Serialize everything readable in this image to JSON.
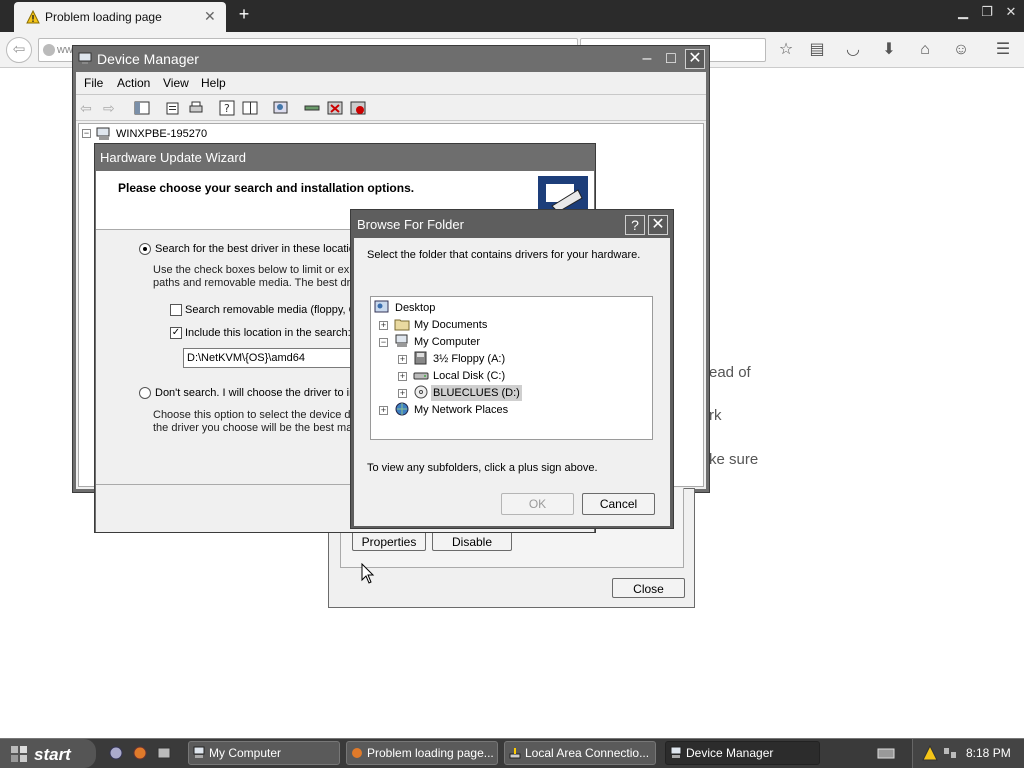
{
  "browser": {
    "tab_title": "Problem loading page",
    "url_prefix": "ww",
    "page_fragments": [
      "ead of",
      "rk",
      "ke sure"
    ]
  },
  "device_manager": {
    "title": "Device Manager",
    "menu": [
      "File",
      "Action",
      "View",
      "Help"
    ],
    "tree_root": "WINXPBE-195270"
  },
  "wizard": {
    "title": "Hardware Update Wizard",
    "heading": "Please choose your search and installation options.",
    "option_search": "Search for the best driver in these location",
    "option_search_desc_1": "Use the check boxes below to limit or exp",
    "option_search_desc_2": "paths and removable media. The best driv",
    "check_removable": "Search removable media (floppy, C",
    "check_include": "Include this location in the search:",
    "path_value": "D:\\NetKVM\\{OS}\\amd64",
    "option_dont": "Don't search. I will choose the driver to in",
    "option_dont_desc_1": "Choose this option to select the device dr",
    "option_dont_desc_2": "the driver you choose will be the best mat"
  },
  "properties_dialog": {
    "properties_label": "Properties",
    "disable_label": "Disable",
    "close_label": "Close"
  },
  "browse": {
    "title": "Browse For Folder",
    "help_label": "?",
    "instruction": "Select the folder that contains drivers for your hardware.",
    "tree": {
      "desktop": "Desktop",
      "my_documents": "My Documents",
      "my_computer": "My Computer",
      "floppy": "3½ Floppy (A:)",
      "local_disk": "Local Disk (C:)",
      "blueclues": "BLUECLUES (D:)",
      "network": "My Network Places"
    },
    "hint": "To view any subfolders, click a plus sign above.",
    "ok_label": "OK",
    "cancel_label": "Cancel"
  },
  "taskbar": {
    "start_label": "start",
    "tasks": [
      "My Computer",
      "Problem loading page...",
      "Local Area Connectio...",
      "Device Manager"
    ],
    "clock": "8:18 PM"
  }
}
